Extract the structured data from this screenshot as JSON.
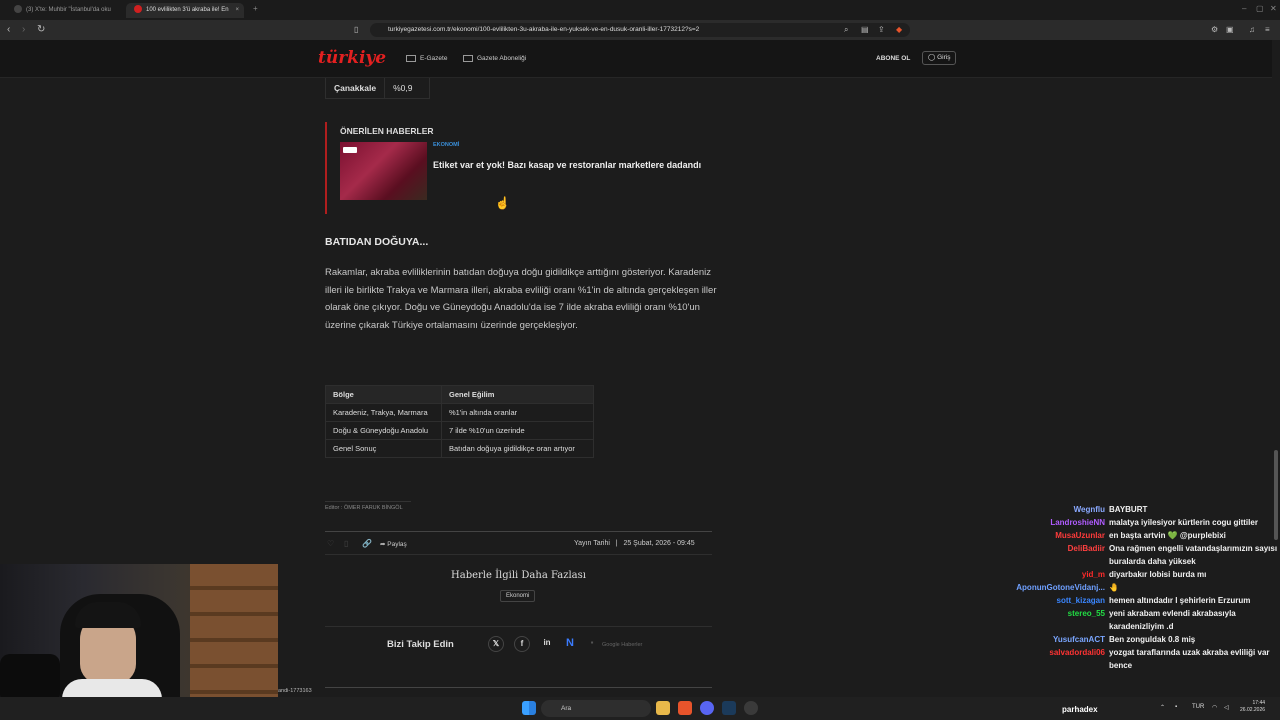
{
  "browser": {
    "tabs": [
      {
        "label": "(3) X'te: Muhbir \"İstanbul'da oku",
        "active": false
      },
      {
        "label": "100 evlilikten 3'ü akraba ile! En",
        "active": true
      }
    ],
    "url": "turkiyegazetesi.com.tr/ekonomi/100-evlilikten-3u-akraba-ile-en-yuksek-ve-en-dusuk-oranli-iller-1773212?s=2"
  },
  "site": {
    "logo": "türkiye",
    "nav": [
      "E-Gazete",
      "Gazete Aboneliği"
    ],
    "subscribe": "ABONE OL",
    "login": "Giriş"
  },
  "top_table": {
    "region": "Çanakkale",
    "value": "%0,9"
  },
  "recommended": {
    "heading": "ÖNERİLEN HABERLER",
    "category": "EKONOMİ",
    "title": "Etiket var et yok! Bazı kasap ve restoranlar marketlere dadandı"
  },
  "article": {
    "section_heading": "BATIDAN DOĞUYA...",
    "paragraph": "Rakamlar, akraba evliliklerinin batıdan doğuya doğu gidildikçe arttığını gösteriyor. Karadeniz illeri ile birlikte Trakya ve Marmara illeri, akraba evliliği oranı %1'in de altında gerçekleşen iller olarak öne çıkıyor. Doğu ve Güneydoğu Anadolu'da ise 7 ilde akraba evliliği oranı %10'un üzerine çıkarak Türkiye ortalamasını üzerinde gerçekleşiyor.",
    "table": {
      "headers": [
        "Bölge",
        "Genel Eğilim"
      ],
      "rows": [
        [
          "Karadeniz, Trakya, Marmara",
          "%1'in altında oranlar"
        ],
        [
          "Doğu & Güneydoğu Anadolu",
          "7 ilde %10'un üzerinde"
        ],
        [
          "Genel Sonuç",
          "Batıdan doğuya gidildikçe oran artıyor"
        ]
      ]
    },
    "editor": "Editor : ÖMER FARUK BİNGÖL",
    "share_label": "Paylaş",
    "pub_label": "Yayın Tarihi",
    "pub_date": "25 Şubat, 2026 - 09:45",
    "more_heading": "Haberle İlgili Daha Fazlası",
    "tag": "Ekonomi",
    "follow_label": "Bizi Takip Edin",
    "google_news": "Google Haberler"
  },
  "stream": {
    "cam_label": "andi-1773163",
    "title": "parhadex",
    "chat": [
      {
        "user": "Wegnflu",
        "color": "#8aa9ff",
        "text": "BAYBURT"
      },
      {
        "user": "LandroshieNN",
        "color": "#b05cff",
        "text": "malatya iyilesiyor kürtlerin cogu gittiler"
      },
      {
        "user": "MusaUzunlar",
        "color": "#ff3b3b",
        "text": "en başta artvin 💚 @purplebixi"
      },
      {
        "user": "DeliBadiir",
        "color": "#ff4040",
        "text": "Ona rağmen engelli vatandaşlarımızın sayısı buralarda daha yüksek"
      },
      {
        "user": "yid_m",
        "color": "#ff2a2a",
        "text": "diyarbakır lobisi burda mı"
      },
      {
        "user": "AponunGotoneVidanj...",
        "color": "#6fa0ff",
        "text": "🤚"
      },
      {
        "user": "sott_kizagan",
        "color": "#3a86ff",
        "text": "hemen altındadır l şehirlerin Erzurum"
      },
      {
        "user": "stereo_55",
        "color": "#22dd44",
        "text": "yeni akrabam evlendi akrabasıyla karadenizliyim .d"
      },
      {
        "user": "YusufcanACT",
        "color": "#7aa6ff",
        "text": "Ben zonguldak 0.8 miş"
      },
      {
        "user": "salvadordali06",
        "color": "#ff3333",
        "text": "yozgat taraflarında uzak akraba evliliği var bence"
      }
    ]
  },
  "taskbar": {
    "search": "Ara",
    "lang": "TUR",
    "time": "17:44",
    "date": "26.02.2026"
  }
}
